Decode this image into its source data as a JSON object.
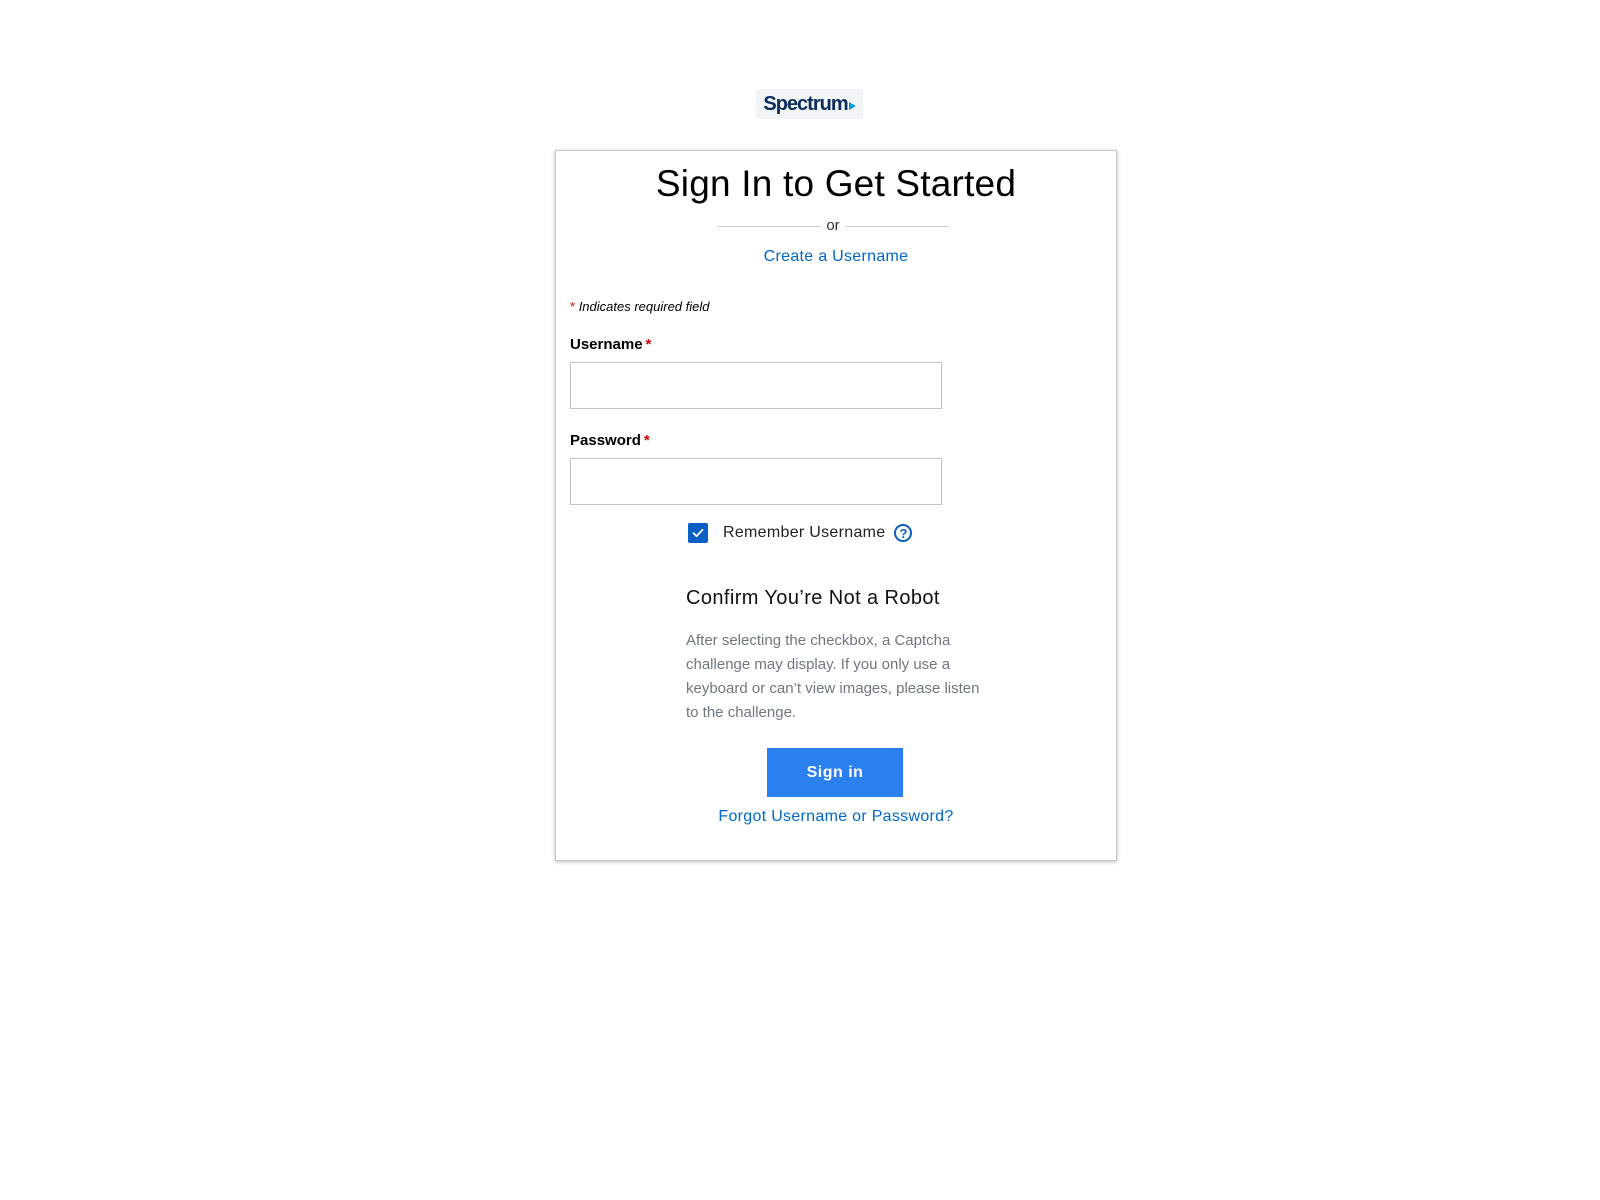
{
  "logo": {
    "text": "Spectrum",
    "icon": "play-arrow-icon"
  },
  "card": {
    "title": "Sign In to Get Started",
    "divider_text": "or",
    "create_username_link": "Create a Username",
    "required_asterisk": "*",
    "required_note": "Indicates required field"
  },
  "form": {
    "username": {
      "label": "Username",
      "value": "",
      "placeholder": ""
    },
    "password": {
      "label": "Password",
      "value": "",
      "placeholder": ""
    },
    "remember": {
      "label": "Remember Username",
      "checked": true,
      "help_icon_glyph": "?"
    }
  },
  "captcha": {
    "title": "Confirm You’re Not a Robot",
    "description": "After selecting the checkbox, a Captcha challenge may display. If you only use a keyboard or can’t view images, please listen to the challenge."
  },
  "actions": {
    "signin_label": "Sign in",
    "forgot_link": "Forgot Username or Password?"
  },
  "colors": {
    "brand_navy": "#0b2e5c",
    "link_blue": "#0068c9",
    "primary_button": "#2b80f0",
    "checkbox_blue": "#0a5fc4",
    "required_red": "#d10000"
  }
}
